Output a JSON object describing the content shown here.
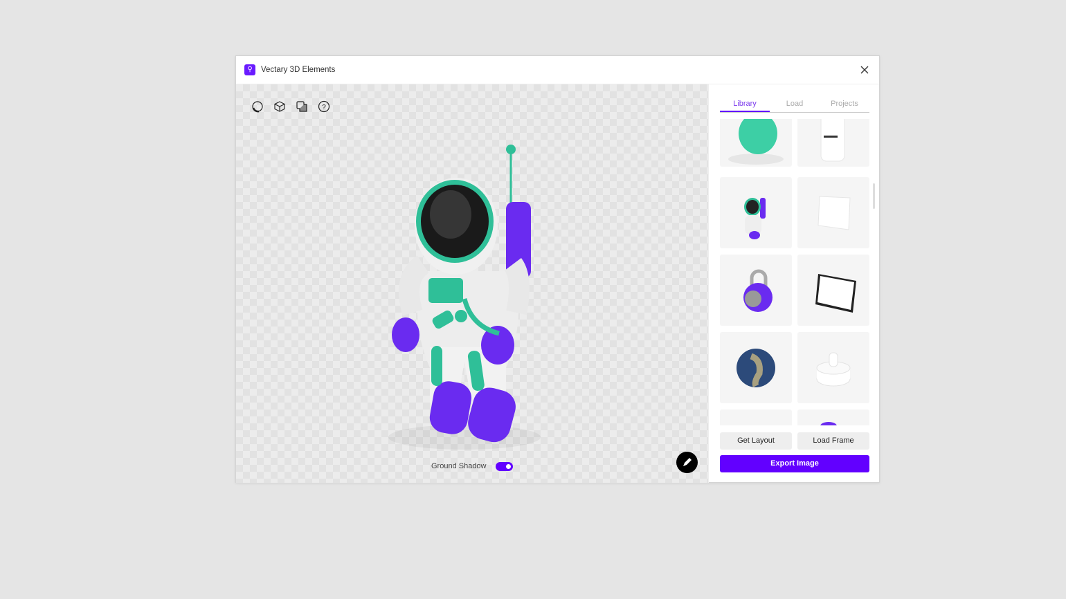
{
  "window": {
    "title": "Vectary 3D Elements",
    "logo_icon": "vectary-logo-icon",
    "close_icon": "close-icon"
  },
  "viewport": {
    "tools": [
      "environment-icon",
      "cube-icon",
      "layers-icon",
      "help-icon"
    ],
    "ground_shadow_label": "Ground Shadow",
    "ground_shadow_on": true,
    "edit_icon": "pencil-icon"
  },
  "sidebar": {
    "tabs": [
      {
        "label": "Library",
        "active": true
      },
      {
        "label": "Load",
        "active": false
      },
      {
        "label": "Projects",
        "active": false
      }
    ],
    "thumbnails": [
      "green-blob",
      "bottle",
      "astronaut",
      "paper-sheet",
      "padlock",
      "tablet",
      "earth-globe",
      "pedestal",
      "blank",
      "purple-object"
    ],
    "buttons": {
      "get_layout": "Get Layout",
      "load_frame": "Load Frame",
      "export": "Export Image"
    }
  },
  "colors": {
    "accent": "#6200ff",
    "teal": "#2fbf98",
    "purple": "#6a2bf0"
  }
}
